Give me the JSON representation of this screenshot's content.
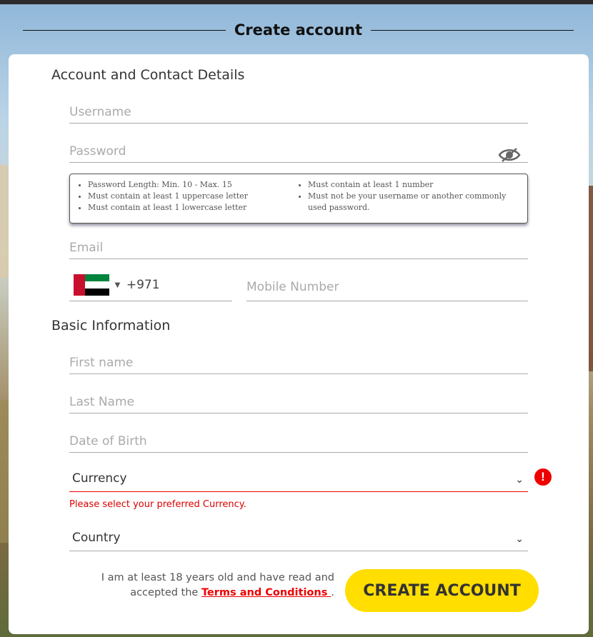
{
  "header": {
    "title": "Create account"
  },
  "sections": {
    "account": "Account and Contact Details",
    "basic": "Basic Information"
  },
  "fields": {
    "username_placeholder": "Username",
    "password_placeholder": "Password",
    "email_placeholder": "Email",
    "mobile_placeholder": "Mobile Number",
    "first_name_placeholder": "First name",
    "last_name_placeholder": "Last Name",
    "dob_placeholder": "Date of Birth"
  },
  "password_rules": {
    "left": [
      "Password Length: Min. 10 - Max. 15",
      "Must contain at least 1 uppercase letter",
      "Must contain at least 1 lowercase letter"
    ],
    "right": [
      "Must contain at least 1 number",
      "Must not be your username or another commonly used password."
    ]
  },
  "phone": {
    "code": "+971",
    "flag": "uae-flag",
    "caret": "▼"
  },
  "currency": {
    "label": "Currency",
    "error": "Please select your preferred Currency.",
    "error_icon": "!"
  },
  "country": {
    "label": "Country"
  },
  "chevron": "⌄",
  "terms": {
    "text": "I am at least 18 years old and have read and accepted the",
    "link": "Terms and Conditions ",
    "suffix": "."
  },
  "submit_label": "CREATE ACCOUNT",
  "colors": {
    "accent": "#ffde00",
    "error": "#e00000",
    "link": "#e00000"
  }
}
